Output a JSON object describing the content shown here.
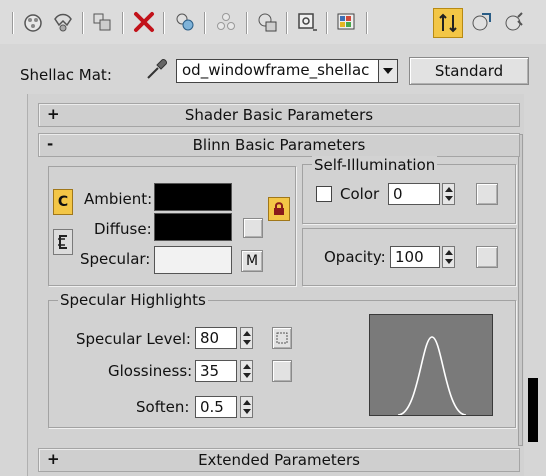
{
  "toolbar": {
    "icons": [
      "get-material-icon",
      "put-to-scene-icon",
      "assign-material-icon",
      "reset-maps-icon",
      "make-copy-icon",
      "make-unique-icon",
      "put-to-library-icon",
      "material-id-icon",
      "show-map-icon",
      "show-end-result-icon",
      "go-to-parent-icon",
      "go-forward-icon"
    ],
    "active_icon": "show-end-result-icon",
    "active_color": "#f3c646"
  },
  "header": {
    "label": "Shellac Mat:",
    "material_name": "od_windowframe_shellac",
    "type_button": "Standard"
  },
  "rollouts": {
    "shader_basic": {
      "sign": "+",
      "title": "Shader Basic Parameters"
    },
    "blinn_basic": {
      "sign": "-",
      "title": "Blinn Basic Parameters"
    },
    "extended": {
      "sign": "+",
      "title": "Extended Parameters"
    }
  },
  "colors": {
    "ambient_label": "Ambient:",
    "diffuse_label": "Diffuse:",
    "specular_label": "Specular:",
    "ambient_color": "#000000",
    "diffuse_color": "#000000",
    "specular_color": "#f2f2f2",
    "lock_button_letter": "C",
    "map_button": "M"
  },
  "self_illumination": {
    "title": "Self-Illumination",
    "color_label": "Color",
    "color_checked": false,
    "value": "0"
  },
  "opacity": {
    "label": "Opacity:",
    "value": "100"
  },
  "specular_highlights": {
    "title": "Specular Highlights",
    "level_label": "Specular Level:",
    "level_value": "80",
    "gloss_label": "Glossiness:",
    "gloss_value": "35",
    "soften_label": "Soften:",
    "soften_value": "0.5"
  }
}
